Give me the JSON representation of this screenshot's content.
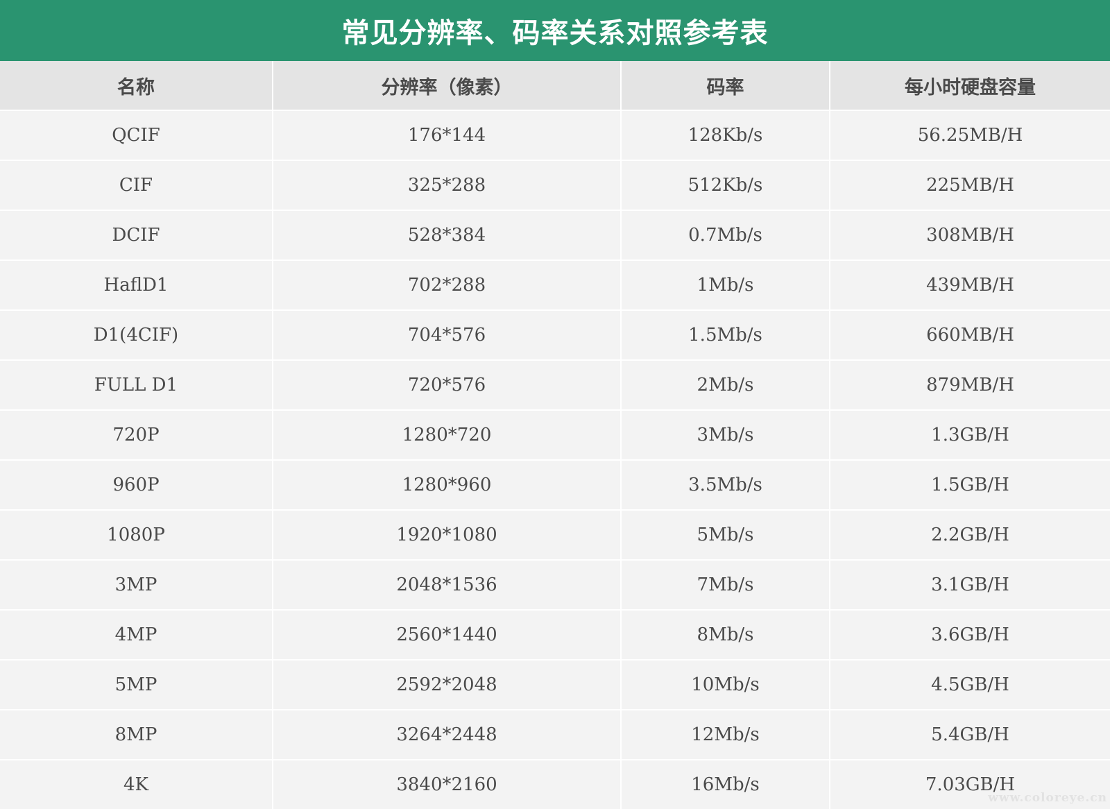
{
  "title": "常见分辨率、码率关系对照参考表",
  "table": {
    "headers": [
      "名称",
      "分辨率（像素）",
      "码率",
      "每小时硬盘容量"
    ],
    "rows": [
      [
        "QCIF",
        "176*144",
        "128Kb/s",
        "56.25MB/H"
      ],
      [
        "CIF",
        "325*288",
        "512Kb/s",
        "225MB/H"
      ],
      [
        "DCIF",
        "528*384",
        "0.7Mb/s",
        "308MB/H"
      ],
      [
        "HaflD1",
        "702*288",
        "1Mb/s",
        "439MB/H"
      ],
      [
        "D1(4CIF)",
        "704*576",
        "1.5Mb/s",
        "660MB/H"
      ],
      [
        "FULL D1",
        "720*576",
        "2Mb/s",
        "879MB/H"
      ],
      [
        "720P",
        "1280*720",
        "3Mb/s",
        "1.3GB/H"
      ],
      [
        "960P",
        "1280*960",
        "3.5Mb/s",
        "1.5GB/H"
      ],
      [
        "1080P",
        "1920*1080",
        "5Mb/s",
        "2.2GB/H"
      ],
      [
        "3MP",
        "2048*1536",
        "7Mb/s",
        "3.1GB/H"
      ],
      [
        "4MP",
        "2560*1440",
        "8Mb/s",
        "3.6GB/H"
      ],
      [
        "5MP",
        "2592*2048",
        "10Mb/s",
        "4.5GB/H"
      ],
      [
        "8MP",
        "3264*2448",
        "12Mb/s",
        "5.4GB/H"
      ],
      [
        "4K",
        "3840*2160",
        "16Mb/s",
        "7.03GB/H"
      ]
    ]
  },
  "watermark": "www.coloreye.cn",
  "colors": {
    "title_background": "#2a9470",
    "header_background": "#e4e4e4",
    "row_background": "#f3f3f3",
    "text": "#4a4a4a"
  }
}
